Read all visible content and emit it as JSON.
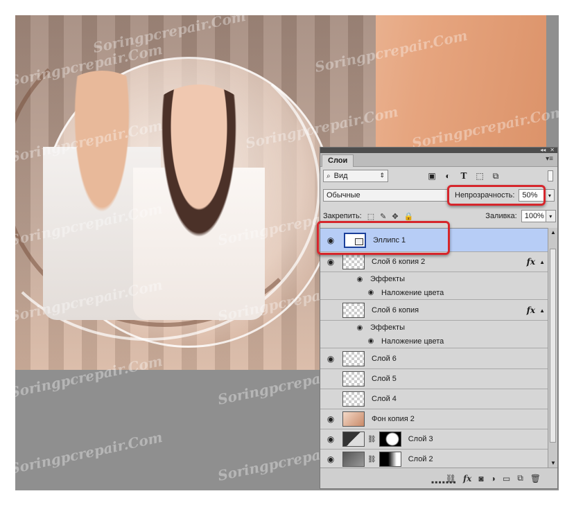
{
  "watermark": "Soringpcrepair.Com",
  "panel": {
    "tab_label": "Слои",
    "filter_kind": "Вид",
    "blend_mode": "Обычные",
    "opacity_label": "Непрозрачность:",
    "opacity_value": "50%",
    "lock_label": "Закрепить:",
    "fill_label": "Заливка:",
    "fill_value": "100%"
  },
  "layers": [
    {
      "name": "Эллипс 1",
      "selected": true
    },
    {
      "name": "Слой 6 копия 2",
      "fx": "fx"
    },
    {
      "effects_label": "Эффекты"
    },
    {
      "effect_name": "Наложение цвета"
    },
    {
      "name": "Слой 6 копия",
      "fx": "fx"
    },
    {
      "effects_label": "Эффекты"
    },
    {
      "effect_name": "Наложение цвета"
    },
    {
      "name": "Слой 6"
    },
    {
      "name": "Слой 5"
    },
    {
      "name": "Слой 4"
    },
    {
      "name": "Фон копия 2"
    },
    {
      "name": "Слой 3"
    },
    {
      "name": "Слой 2"
    }
  ],
  "colors": {
    "highlight": "#d6262c",
    "selected_layer": "#b7cdf6",
    "panel_bg": "#d6d6d6",
    "workspace_bg": "#8f8f8f"
  }
}
